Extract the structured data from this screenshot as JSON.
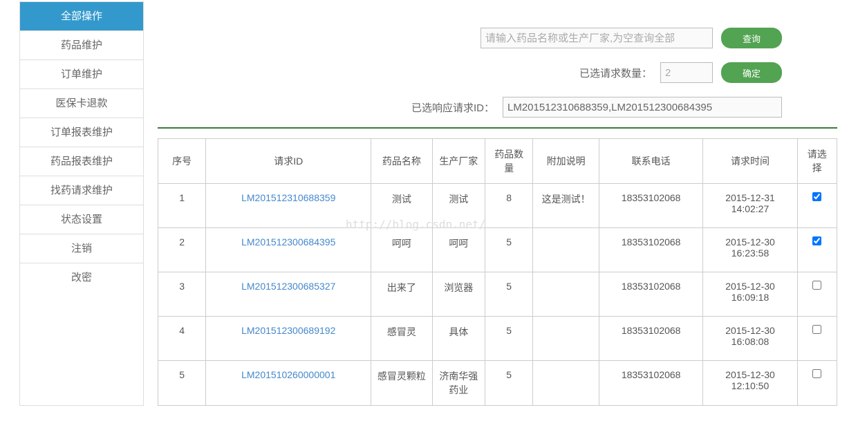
{
  "sidebar": {
    "items": [
      {
        "label": "全部操作",
        "active": true
      },
      {
        "label": "药品维护",
        "active": false
      },
      {
        "label": "订单维护",
        "active": false
      },
      {
        "label": "医保卡退款",
        "active": false
      },
      {
        "label": "订单报表维护",
        "active": false
      },
      {
        "label": "药品报表维护",
        "active": false
      },
      {
        "label": "找药请求维护",
        "active": false
      },
      {
        "label": "状态设置",
        "active": false
      },
      {
        "label": "注销",
        "active": false
      },
      {
        "label": "改密",
        "active": false
      }
    ]
  },
  "search": {
    "placeholder": "请输入药品名称或生产厂家,为空查询全部",
    "button": "查询"
  },
  "selected_count": {
    "label": "已选请求数量：",
    "value": "2",
    "button": "确定"
  },
  "selected_ids": {
    "label": "已选响应请求ID：",
    "value": "LM201512310688359,LM201512300684395"
  },
  "watermark": "http://blog.csdn.net/",
  "table": {
    "headers": [
      "序号",
      "请求ID",
      "药品名称",
      "生产厂家",
      "药品数量",
      "附加说明",
      "联系电话",
      "请求时间",
      "请选择"
    ],
    "rows": [
      {
        "seq": "1",
        "id": "LM201512310688359",
        "name": "测试",
        "manu": "测试",
        "qty": "8",
        "note": "这是测试！",
        "phone": "18353102068",
        "time": "2015-12-31 14:02:27",
        "checked": true
      },
      {
        "seq": "2",
        "id": "LM201512300684395",
        "name": "呵呵",
        "manu": "呵呵",
        "qty": "5",
        "note": "",
        "phone": "18353102068",
        "time": "2015-12-30 16:23:58",
        "checked": true
      },
      {
        "seq": "3",
        "id": "LM201512300685327",
        "name": "出来了",
        "manu": "浏览器",
        "qty": "5",
        "note": "",
        "phone": "18353102068",
        "time": "2015-12-30 16:09:18",
        "checked": false
      },
      {
        "seq": "4",
        "id": "LM201512300689192",
        "name": "感冒灵",
        "manu": "具体",
        "qty": "5",
        "note": "",
        "phone": "18353102068",
        "time": "2015-12-30 16:08:08",
        "checked": false
      },
      {
        "seq": "5",
        "id": "LM201510260000001",
        "name": "感冒灵颗粒",
        "manu": "济南华强药业",
        "qty": "5",
        "note": "",
        "phone": "18353102068",
        "time": "2015-12-30 12:10:50",
        "checked": false
      }
    ]
  }
}
